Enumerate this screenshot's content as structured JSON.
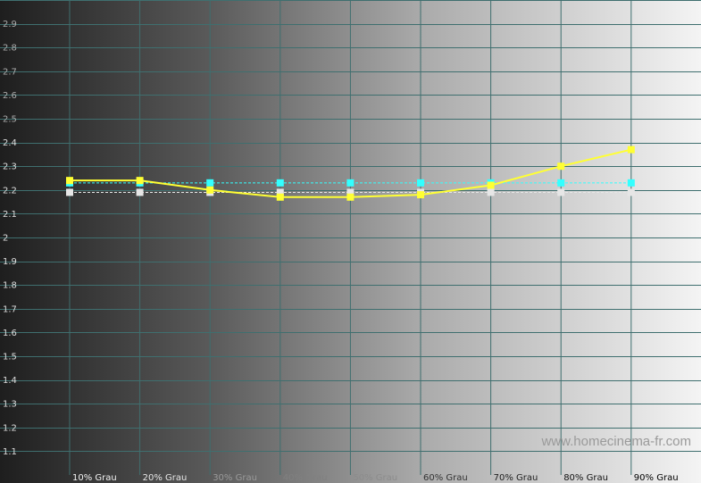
{
  "chart_data": {
    "type": "line",
    "categories": [
      "10% Grau",
      "20% Grau",
      "30% Grau",
      "40% Grau",
      "50% Grau",
      "60% Grau",
      "70% Grau",
      "80% Grau",
      "90% Grau"
    ],
    "ylim": [
      1.0,
      3.0
    ],
    "yticks": [
      1.1,
      1.2,
      1.3,
      1.4,
      1.5,
      1.6,
      1.7,
      1.8,
      1.9,
      2,
      2.1,
      2.2,
      2.3,
      2.4,
      2.5,
      2.6,
      2.7,
      2.8,
      2.9
    ],
    "grid": true,
    "series": [
      {
        "color": "#ffff33",
        "style": "solid",
        "values": [
          2.24,
          2.24,
          2.2,
          2.17,
          2.17,
          2.18,
          2.22,
          2.3,
          2.37
        ]
      },
      {
        "color": "#33ffff",
        "style": "dashed",
        "values": [
          2.23,
          2.23,
          2.23,
          2.23,
          2.23,
          2.23,
          2.23,
          2.23,
          2.23
        ]
      },
      {
        "color": "#e6e6e6",
        "style": "dashed",
        "values": [
          2.19,
          2.19,
          2.19,
          2.19,
          2.19,
          2.19,
          2.19,
          2.19,
          2.19
        ]
      }
    ],
    "watermark": "www.homecinema-fr.com"
  }
}
